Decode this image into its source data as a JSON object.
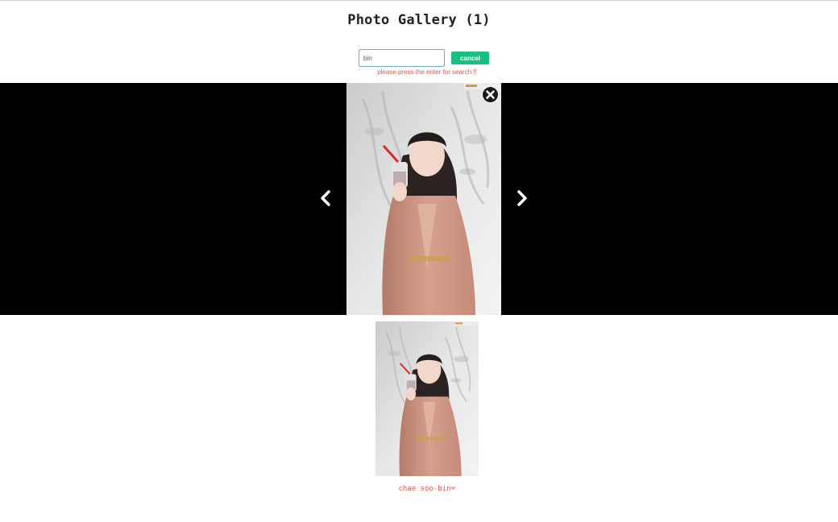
{
  "page": {
    "title": "Photo Gallery (1)"
  },
  "search": {
    "value": "bin",
    "cancel_label": "cancel",
    "hint": "please press the enter for search !!"
  },
  "lightbox": {
    "prev_icon": "chevron-left-icon",
    "next_icon": "chevron-right-icon",
    "close_icon": "close-icon"
  },
  "gallery": {
    "items": [
      {
        "caption": "chae soo-bin",
        "icon": "heart-icon"
      }
    ]
  },
  "colors": {
    "accent": "#17c083",
    "hint_text": "#e0554a",
    "lightbox_bg": "#000000",
    "heart": "#f4a9b0"
  }
}
